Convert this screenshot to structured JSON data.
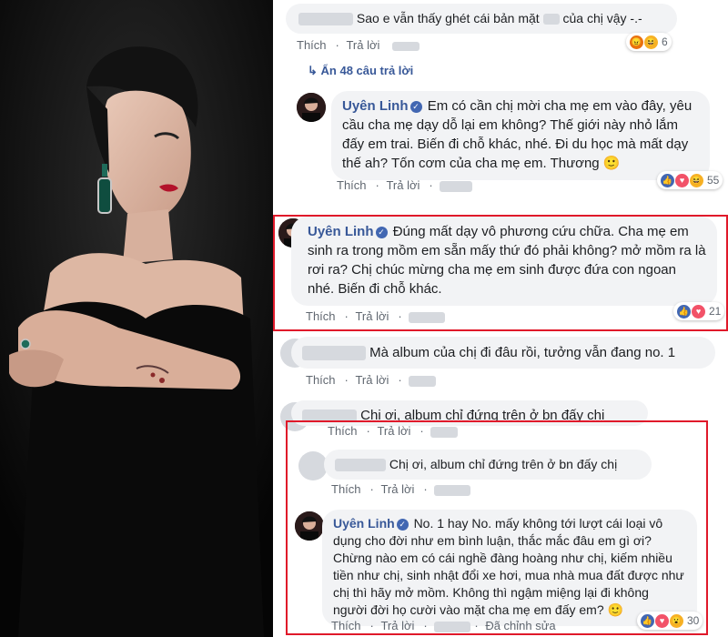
{
  "actions": {
    "like": "Thích",
    "reply": "Trả lời",
    "edited": "Đã chỉnh sửa"
  },
  "top_comment": {
    "text": "Sao e vẫn thấy ghét cái bản mặt",
    "text_end": "của chị vậy -.-",
    "reactions": "6"
  },
  "view_more": {
    "arrow": "↳",
    "label": "Ẩn 48 câu trả lời"
  },
  "reply1": {
    "author": "Uyên Linh",
    "text": "Em có cần chị mời cha mẹ em vào đây, yêu cầu cha mẹ dạy dỗ lại em không? Thế giới này nhỏ lắm đấy em trai. Biến đi chỗ khác, nhé. Đi du học mà mất dạy thế ah? Tốn cơm của cha mẹ em. Thương",
    "emoji": "🙂",
    "reactions": "55"
  },
  "reply2": {
    "author": "Uyên Linh",
    "text": "Đúng mất dạy vô phương cứu chữa. Cha mẹ em sinh ra trong mồm em sẵn mấy thứ đó phải không? mở mồm ra là rơi ra? Chị chúc mừng cha mẹ em sinh được đứa con ngoan nhé. Biến đi chỗ khác.",
    "reactions": "21"
  },
  "comment3": {
    "text": "Mà album của chị đi đâu rồi, tưởng vẫn đang no. 1"
  },
  "comment4": {
    "text": "Chị ơi, album chỉ đứng trên ở bn đấy chị"
  },
  "comment5": {
    "text": "Chị ơi, album chỉ đứng trên ở bn đấy chị"
  },
  "reply3": {
    "author": "Uyên Linh",
    "text": "No. 1 hay No. mấy không tới lượt cái loại vô dụng cho đời như em bình luận, thắc mắc đâu em gì ơi? Chừng nào em có cái nghề đàng hoàng như chị, kiếm nhiều tiền như chị, sinh nhật đổi xe hơi, mua nhà mua đất được như chị thì hãy mở mồm. Không thì ngậm miệng lại đi không người đời họ cười vào mặt cha mẹ em đấy em?",
    "emoji": "🙂",
    "reactions": "30"
  },
  "icons": {
    "like": "👍",
    "love": "♥",
    "haha": "😆",
    "angry": "😠",
    "wow": "😮",
    "verified": "✓"
  }
}
